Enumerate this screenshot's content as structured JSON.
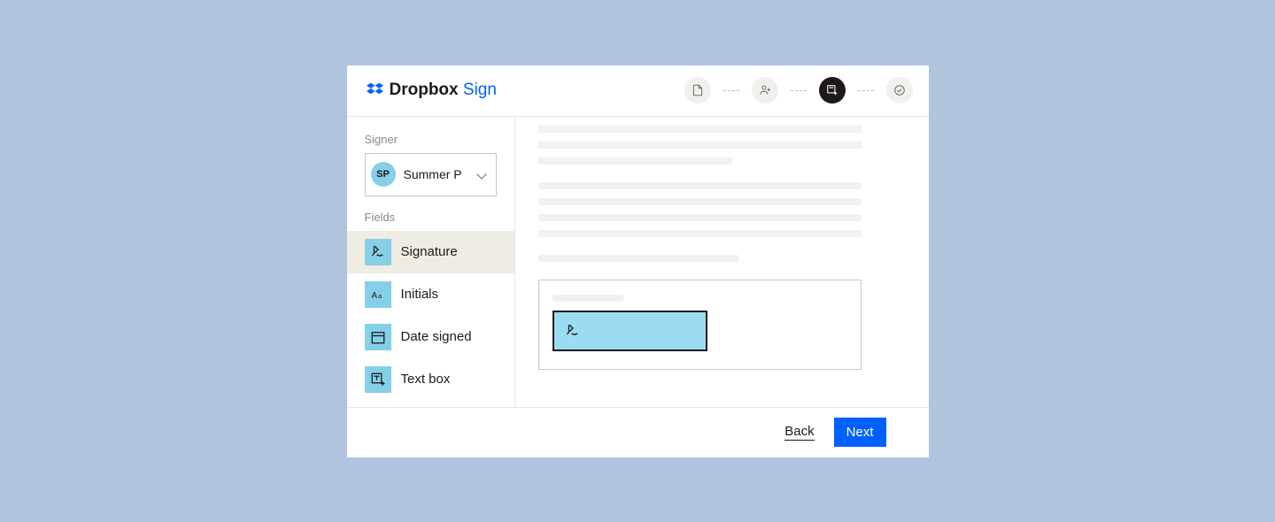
{
  "brand": {
    "name": "Dropbox ",
    "suffix": "Sign"
  },
  "sidebar": {
    "signer_label": "Signer",
    "signer": {
      "initials": "SP",
      "name": "Summer P"
    },
    "fields_label": "Fields",
    "fields": [
      {
        "label": "Signature"
      },
      {
        "label": "Initials"
      },
      {
        "label": "Date signed"
      },
      {
        "label": "Text box"
      }
    ]
  },
  "footer": {
    "back": "Back",
    "next": "Next"
  }
}
